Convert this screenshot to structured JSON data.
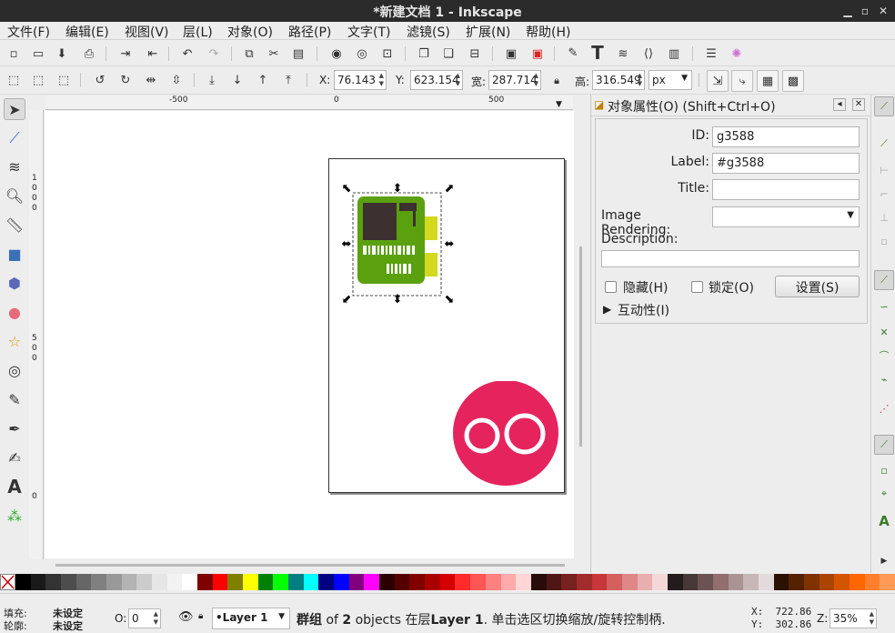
{
  "window": {
    "title": "*新建文档 1 - Inkscape"
  },
  "menu": [
    "文件(F)",
    "编辑(E)",
    "视图(V)",
    "层(L)",
    "对象(O)",
    "路径(P)",
    "文字(T)",
    "滤镜(S)",
    "扩展(N)",
    "帮助(H)"
  ],
  "coords_toolbar": {
    "x_label": "X:",
    "x_value": "76.143",
    "y_label": "Y:",
    "y_value": "623.154",
    "w_label": "宽:",
    "w_value": "287.714",
    "h_label": "高:",
    "h_value": "316.549",
    "unit": "px"
  },
  "ruler": {
    "h_ticks": [
      "-500",
      "0",
      "500"
    ],
    "v_ticks": [
      "1\n0\n0\n0",
      "5\n0\n0",
      "0"
    ]
  },
  "dialog": {
    "title": "对象属性(O) (Shift+Ctrl+O)",
    "id_label": "ID:",
    "id_value": "g3588",
    "label_label": "Label:",
    "label_value": "#g3588",
    "title_label": "Title:",
    "title_value": "",
    "rendering_label": "Image Rendering:",
    "rendering_value": "",
    "description_label": "Description:",
    "hide_label": "隐藏(H)",
    "lock_label": "锁定(O)",
    "set_button": "设置(S)",
    "interactivity_label": "互动性(I)"
  },
  "palette_colors": [
    "#000000",
    "#1a1a1a",
    "#333333",
    "#4d4d4d",
    "#666666",
    "#808080",
    "#999999",
    "#b3b3b3",
    "#cccccc",
    "#e6e6e6",
    "#f2f2f2",
    "#ffffff",
    "#800000",
    "#ff0000",
    "#808000",
    "#ffff00",
    "#008000",
    "#00ff00",
    "#008080",
    "#00ffff",
    "#000080",
    "#0000ff",
    "#800080",
    "#ff00ff",
    "#2b0000",
    "#550000",
    "#800000",
    "#aa0000",
    "#d40000",
    "#ff2a2a",
    "#ff5555",
    "#ff8080",
    "#ffaaaa",
    "#ffd5d5",
    "#280b0b",
    "#501616",
    "#782121",
    "#a02c2c",
    "#c83737",
    "#d35f5f",
    "#de8787",
    "#e9afaf",
    "#f4d7d7",
    "#241c1c",
    "#483737",
    "#6c5353",
    "#916f6f",
    "#ac9393",
    "#c8b7b7",
    "#e3dbdb",
    "#2b1100",
    "#552200",
    "#803300",
    "#aa4400",
    "#d45500",
    "#ff6600",
    "#ff7f2a",
    "#ff9955"
  ],
  "status": {
    "fill_label": "填充:",
    "fill_value": "未设定",
    "stroke_label": "轮廓:",
    "stroke_value": "未设定",
    "opacity_label": "O:",
    "opacity_value": "0",
    "layer": "•Layer 1",
    "message_bold1": "群组",
    "message_1": " of ",
    "message_bold2": "2",
    "message_2": " objects 在层",
    "message_bold3": "Layer 1",
    "message_3": ". 单击选区切换缩放/旋转控制柄.",
    "x_readout": "X:  722.86",
    "y_readout": "Y:  302.86",
    "zoom_label": "Z:",
    "zoom_value": "35%"
  },
  "colors": {
    "board_green": "#5ba10f",
    "chip_dark": "#3c3030",
    "pin_yellow": "#d4d81e",
    "circle_pink": "#e5245e"
  }
}
